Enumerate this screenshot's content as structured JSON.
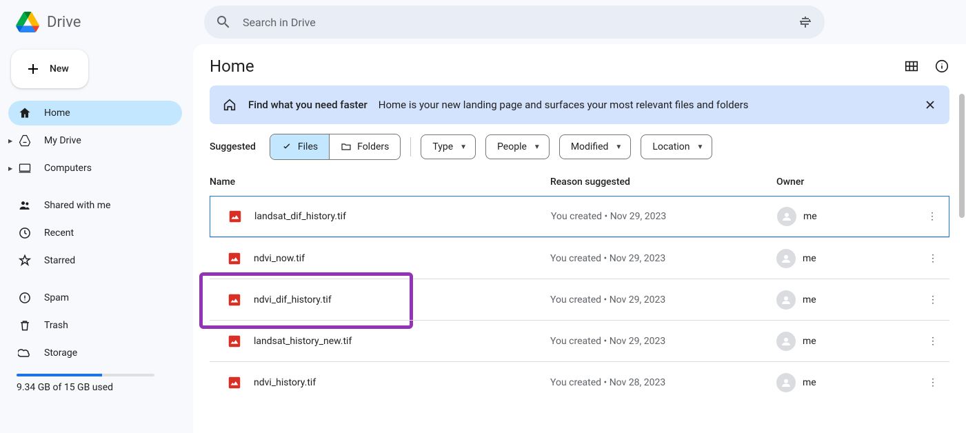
{
  "app": {
    "name": "Drive"
  },
  "search": {
    "placeholder": "Search in Drive"
  },
  "sidebar": {
    "new_label": "New",
    "items": [
      {
        "label": "Home"
      },
      {
        "label": "My Drive"
      },
      {
        "label": "Computers"
      },
      {
        "label": "Shared with me"
      },
      {
        "label": "Recent"
      },
      {
        "label": "Starred"
      },
      {
        "label": "Spam"
      },
      {
        "label": "Trash"
      },
      {
        "label": "Storage"
      }
    ],
    "storage": {
      "used_text": "9.34 GB of 15 GB used",
      "percent": 62
    }
  },
  "main": {
    "title": "Home",
    "banner": {
      "strong": "Find what you need faster",
      "text": "Home is your new landing page and surfaces your most relevant files and folders"
    },
    "suggested_label": "Suggested",
    "seg": {
      "files": "Files",
      "folders": "Folders"
    },
    "chips": {
      "type": "Type",
      "people": "People",
      "modified": "Modified",
      "location": "Location"
    },
    "columns": {
      "name": "Name",
      "reason": "Reason suggested",
      "owner": "Owner"
    },
    "rows": [
      {
        "name": "landsat_dif_history.tif",
        "reason": "You created • Nov 29, 2023",
        "owner": "me"
      },
      {
        "name": "ndvi_now.tif",
        "reason": "You created • Nov 29, 2023",
        "owner": "me"
      },
      {
        "name": "ndvi_dif_history.tif",
        "reason": "You created • Nov 29, 2023",
        "owner": "me"
      },
      {
        "name": "landsat_history_new.tif",
        "reason": "You created • Nov 29, 2023",
        "owner": "me"
      },
      {
        "name": "ndvi_history.tif",
        "reason": "You created • Nov 28, 2023",
        "owner": "me"
      }
    ]
  }
}
